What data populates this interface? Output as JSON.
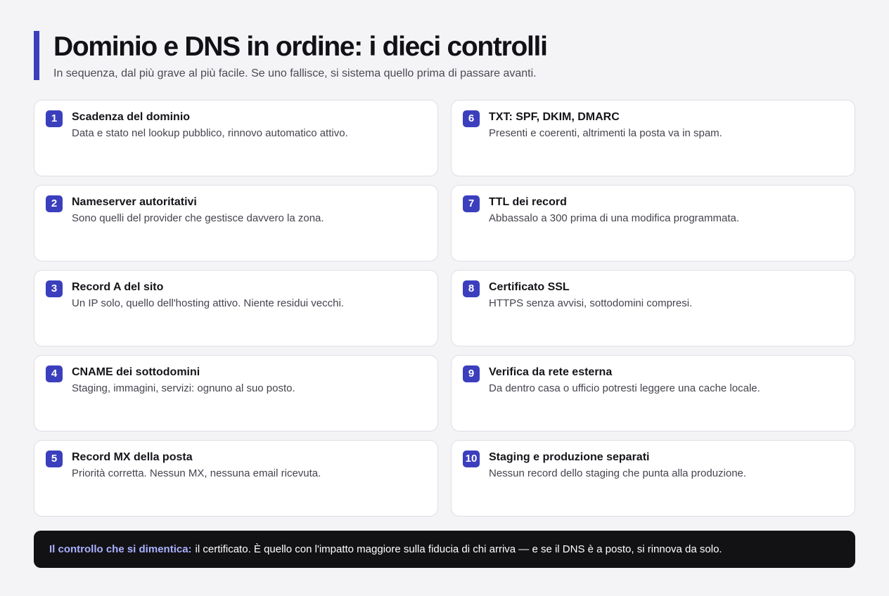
{
  "header": {
    "title": "Dominio e DNS in ordine: i dieci controlli",
    "subtitle": "In sequenza, dal più grave al più facile. Se uno fallisce, si sistema quello prima di passare avanti."
  },
  "checks": [
    {
      "number": "1",
      "title": "Scadenza del dominio",
      "description": "Data e stato nel lookup pubblico, rinnovo automatico attivo."
    },
    {
      "number": "2",
      "title": "Nameserver autoritativi",
      "description": "Sono quelli del provider che gestisce davvero la zona."
    },
    {
      "number": "3",
      "title": "Record A del sito",
      "description": "Un IP solo, quello dell'hosting attivo. Niente residui vecchi."
    },
    {
      "number": "4",
      "title": "CNAME dei sottodomini",
      "description": "Staging, immagini, servizi: ognuno al suo posto."
    },
    {
      "number": "5",
      "title": "Record MX della posta",
      "description": "Priorità corretta. Nessun MX, nessuna email ricevuta."
    },
    {
      "number": "6",
      "title": "TXT: SPF, DKIM, DMARC",
      "description": "Presenti e coerenti, altrimenti la posta va in spam."
    },
    {
      "number": "7",
      "title": "TTL dei record",
      "description": "Abbassalo a 300 prima di una modifica programmata."
    },
    {
      "number": "8",
      "title": "Certificato SSL",
      "description": "HTTPS senza avvisi, sottodomini compresi."
    },
    {
      "number": "9",
      "title": "Verifica da rete esterna",
      "description": "Da dentro casa o ufficio potresti leggere una cache locale."
    },
    {
      "number": "10",
      "title": "Staging e produzione separati",
      "description": "Nessun record dello staging che punta alla produzione."
    }
  ],
  "footer": {
    "label": "Il controllo che si dimentica:",
    "text": "il certificato. È quello con l'impatto maggiore sulla fiducia di chi arriva — e se il DNS è a posto, si rinnova da solo."
  },
  "colors": {
    "accent": "#3b3fbd",
    "footer_background": "#121215",
    "footer_label": "#aab0ff"
  }
}
